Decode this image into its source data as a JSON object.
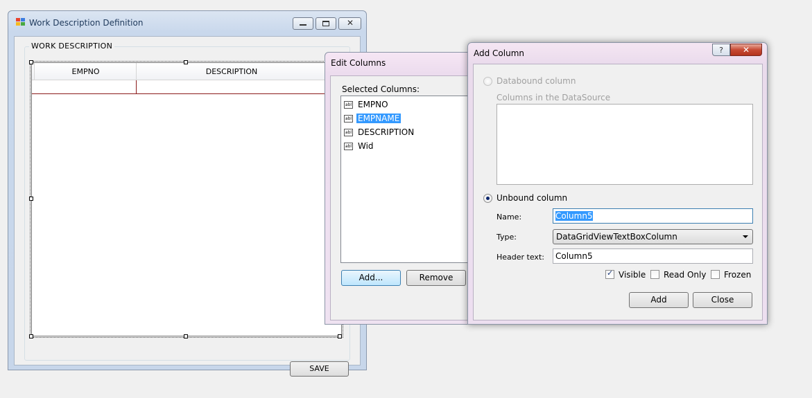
{
  "main_window": {
    "title": "Work Description Definition",
    "group_label": "WORK DESCRIPTION",
    "columns": [
      "EMPNO",
      "DESCRIPTION"
    ],
    "save_label": "SAVE"
  },
  "edit_columns": {
    "title": "Edit Columns",
    "selected_label": "Selected Columns:",
    "items": [
      "EMPNO",
      "EMPNAME",
      "DESCRIPTION",
      "Wid"
    ],
    "selected_index": 1,
    "add_label": "Add...",
    "remove_label": "Remove"
  },
  "add_column": {
    "title": "Add Column",
    "help_glyph": "?",
    "close_glyph": "✕",
    "databound_label": "Databound column",
    "datasource_label": "Columns in the DataSource",
    "unbound_label": "Unbound column",
    "name_label": "Name:",
    "name_value": "Column5",
    "type_label": "Type:",
    "type_value": "DataGridViewTextBoxColumn",
    "header_label": "Header text:",
    "header_value": "Column5",
    "visible_label": "Visible",
    "readonly_label": "Read Only",
    "frozen_label": "Frozen",
    "add_label": "Add",
    "close_label": "Close"
  },
  "icons": [
    "app-icon",
    "minimize-icon",
    "maximize-icon",
    "close-icon",
    "textbox-column-icon",
    "help-icon",
    "dropdown-arrow-icon",
    "checkmark-icon"
  ]
}
